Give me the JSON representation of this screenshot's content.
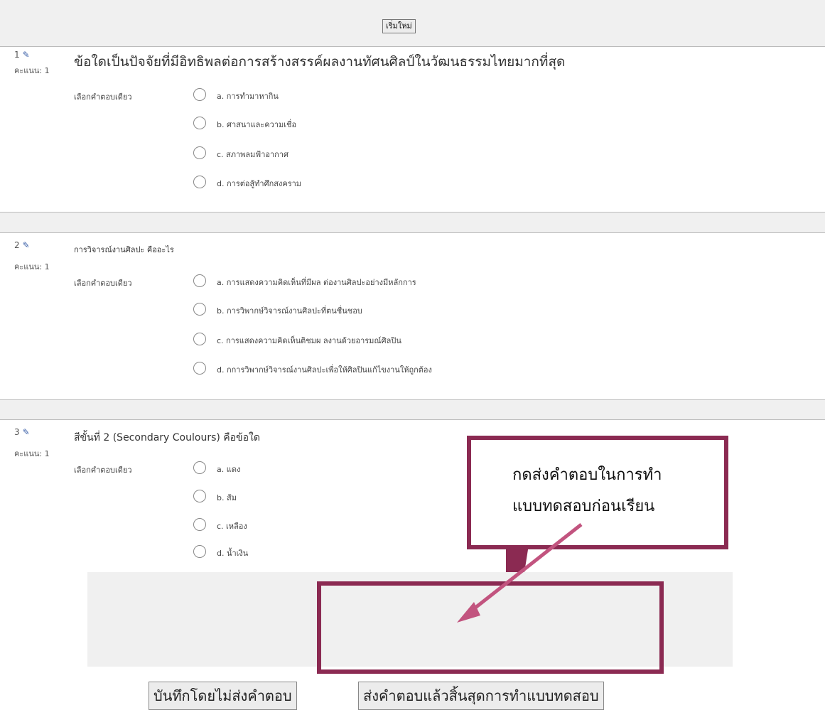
{
  "toolbar": {
    "restart_label": "เริ่มใหม่"
  },
  "labels": {
    "score": "คะแนน: 1",
    "single_answer": "เลือกคำตอบเดียว"
  },
  "questions": [
    {
      "number": "1",
      "text": "ข้อใดเป็นปัจจัยที่มีอิทธิพลต่อการสร้างสรรค์ผลงานทัศนศิลป์ในวัฒนธรรมไทยมากที่สุด",
      "options": [
        "a. การทำมาหากิน",
        "b. ศาสนาและความเชื่อ",
        "c. สภาพลมฟ้าอากาศ",
        "d. การต่อสู้ทำศึกสงคราม"
      ]
    },
    {
      "number": "2",
      "text": "การวิจารณ์งานศิลปะ คืออะไร",
      "options": [
        "a. การแสดงความคิดเห็นที่มีผล ต่องานศิลปะอย่างมีหลักการ",
        "b. การวิพากษ์วิจารณ์งานศิลปะที่ตนชื่นชอบ",
        "c. การแสดงความคิดเห็นติชมผ ลงานด้วยอารมณ์ศิลปิน",
        "d. กการวิพากษ์วิจารณ์งานศิลปะเพื่อให้ศิลปินแก้ไขงานให้ถูกต้อง"
      ]
    },
    {
      "number": "3",
      "text": "สีขั้นที่ 2 (Secondary Coulours) คือข้อใด",
      "options": [
        "a. แดง",
        "b. ส้ม",
        "c. เหลือง",
        "d. น้ำเงิน"
      ]
    }
  ],
  "footer": {
    "save_label": "บันทึกโดยไม่ส่งคำตอบ",
    "submit_label": "ส่งคำตอบแล้วสิ้นสุดการทำแบบทดสอบ"
  },
  "callout": {
    "line1": "กดส่งคำตอบในการทำ",
    "line2": "แบบทดสอบก่อนเรียน"
  },
  "icons": {
    "edit": "pencil-icon"
  },
  "colors": {
    "callout_border": "#8b2a52",
    "pointer": "#c2547f"
  }
}
